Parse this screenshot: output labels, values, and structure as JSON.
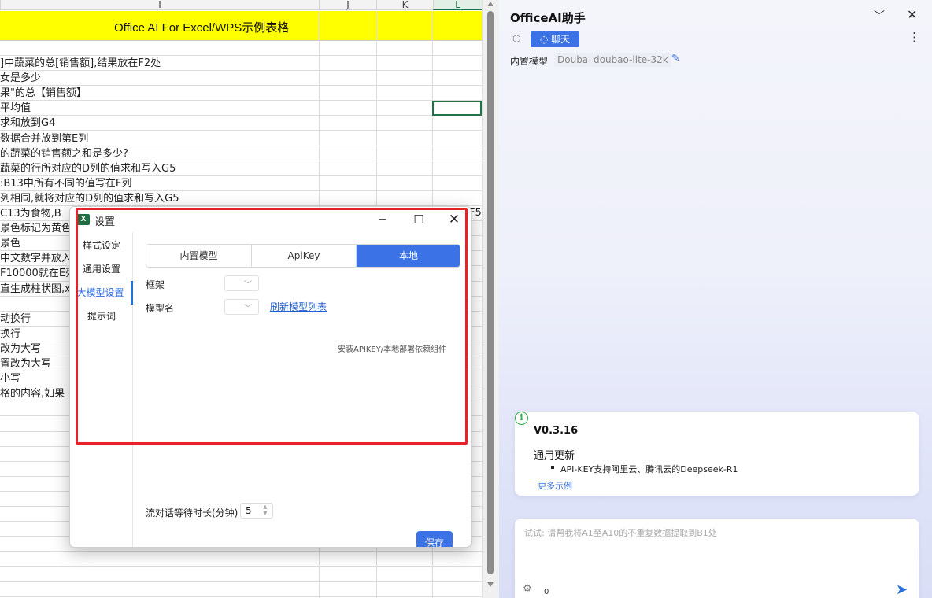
{
  "sheet": {
    "columns": [
      "I",
      "J",
      "K",
      "L"
    ],
    "banner_title": "Office AI For Excel/WPS示例表格",
    "rows": [
      "]中蔬菜的总[销售额],结果放在F2处",
      "女是多少",
      "果\"的总【销售额】",
      "平均值",
      "求和放到G4",
      "数据合并放到第E列",
      "的蔬菜的销售额之和是多少?",
      "蔬菜的行所对应的D列的值求和写入G5",
      ":B13中所有不同的值写在F列",
      "列相同,就将对应的D列的值求和写入G5",
      "C13为食物,B",
      "景色标记为黄色",
      "景色",
      "中文数字并放入",
      "F10000就在E列",
      "直生成柱状图,x",
      "",
      "动换行",
      "换行",
      "改为大写",
      "置改为大写",
      "小写",
      "格的内容,如果"
    ],
    "row_fragment_right": "F5"
  },
  "dialog": {
    "title": "设置",
    "sidebar": [
      "样式设定",
      "通用设置",
      "大模型设置",
      "提示词"
    ],
    "active_sidebar_index": 2,
    "tabs": [
      "内置模型",
      "ApiKey",
      "本地"
    ],
    "active_tab_index": 2,
    "framework_label": "框架",
    "model_name_label": "模型名",
    "refresh_link": "刷新模型列表",
    "install_note": "安装APIKEY/本地部署依赖组件",
    "wait_label": "流对话等待时长(分钟)",
    "wait_value": "5",
    "save_label": "保存"
  },
  "panel": {
    "title": "OfficeAI助手",
    "chat_tab": "聊天",
    "model_label": "内置模型",
    "model_chip_1": "Douba",
    "model_chip_2": "doubao-lite-32k",
    "update": {
      "version": "V0.3.16",
      "heading": "通用更新",
      "item": "API-KEY支持阿里云、腾讯云的Deepseek-R1",
      "more": "更多示例"
    },
    "input_placeholder": "试试: 请帮我将A1至A10的不重复数据提取到B1处",
    "char_count": "0"
  },
  "colors": {
    "accent": "#3b73e6",
    "banner": "#ffff00",
    "annotation_red": "#e8212b",
    "excel_green": "#217346"
  },
  "icons": [
    "excel-app-icon",
    "minimize-icon",
    "maximize-icon",
    "close-icon",
    "chevron-down-icon",
    "cube-icon",
    "chat-bubble-icon",
    "more-vertical-icon",
    "edit-pencil-icon",
    "info-icon",
    "gear-icon",
    "send-icon"
  ]
}
